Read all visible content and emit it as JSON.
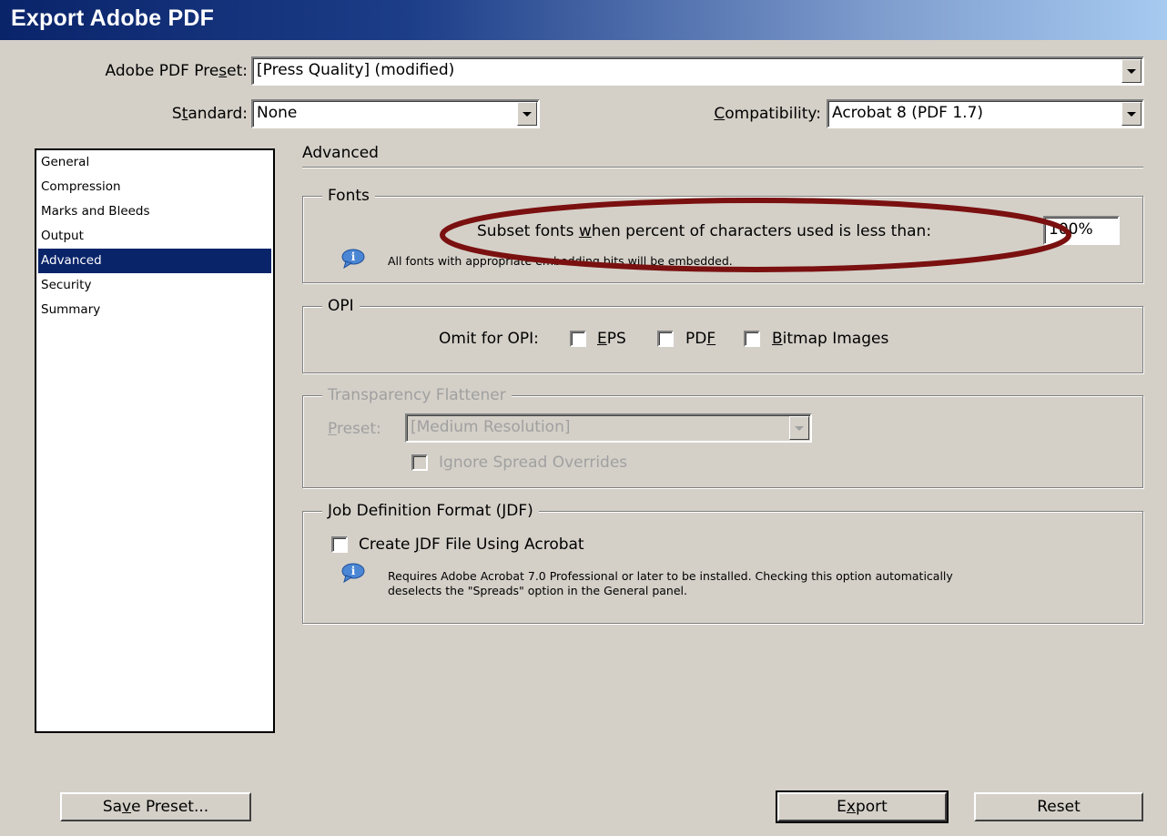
{
  "window": {
    "title": "Export Adobe PDF"
  },
  "preset": {
    "label": "Adobe PDF Preset:",
    "value": "[Press Quality] (modified)"
  },
  "standard": {
    "label": "Standard:",
    "value": "None"
  },
  "compatibility": {
    "label": "Compatibility:",
    "value": "Acrobat 8 (PDF 1.7)"
  },
  "sidebar": {
    "items": [
      {
        "label": "General"
      },
      {
        "label": "Compression"
      },
      {
        "label": "Marks and Bleeds"
      },
      {
        "label": "Output"
      },
      {
        "label": "Advanced",
        "selected": true
      },
      {
        "label": "Security"
      },
      {
        "label": "Summary"
      }
    ]
  },
  "panel": {
    "title": "Advanced"
  },
  "fonts": {
    "legend": "Fonts",
    "subset_label": "Subset fonts when percent of characters used is less than:",
    "subset_value": "100%",
    "info": "All fonts with appropriate embedding bits will be embedded."
  },
  "opi": {
    "legend": "OPI",
    "omit_label": "Omit for OPI:",
    "eps_label": "EPS",
    "pdf_label": "PDF",
    "bitmap_label": "Bitmap Images"
  },
  "transparency": {
    "legend": "Transparency Flattener",
    "preset_label": "Preset:",
    "preset_value": "[Medium Resolution]",
    "ignore_label": "Ignore Spread Overrides"
  },
  "jdf": {
    "legend": "Job Definition Format (JDF)",
    "create_label": "Create JDF File Using Acrobat",
    "info_line1": "Requires Adobe Acrobat 7.0 Professional or later to be installed. Checking this option automatically",
    "info_line2": "deselects the \"Spreads\" option in the General panel."
  },
  "buttons": {
    "save_preset": "Save Preset...",
    "export": "Export",
    "reset": "Reset"
  },
  "colors": {
    "highlight_ellipse": "#7a1010",
    "selection": "#0a246a",
    "title_bar": "#0a246a"
  }
}
